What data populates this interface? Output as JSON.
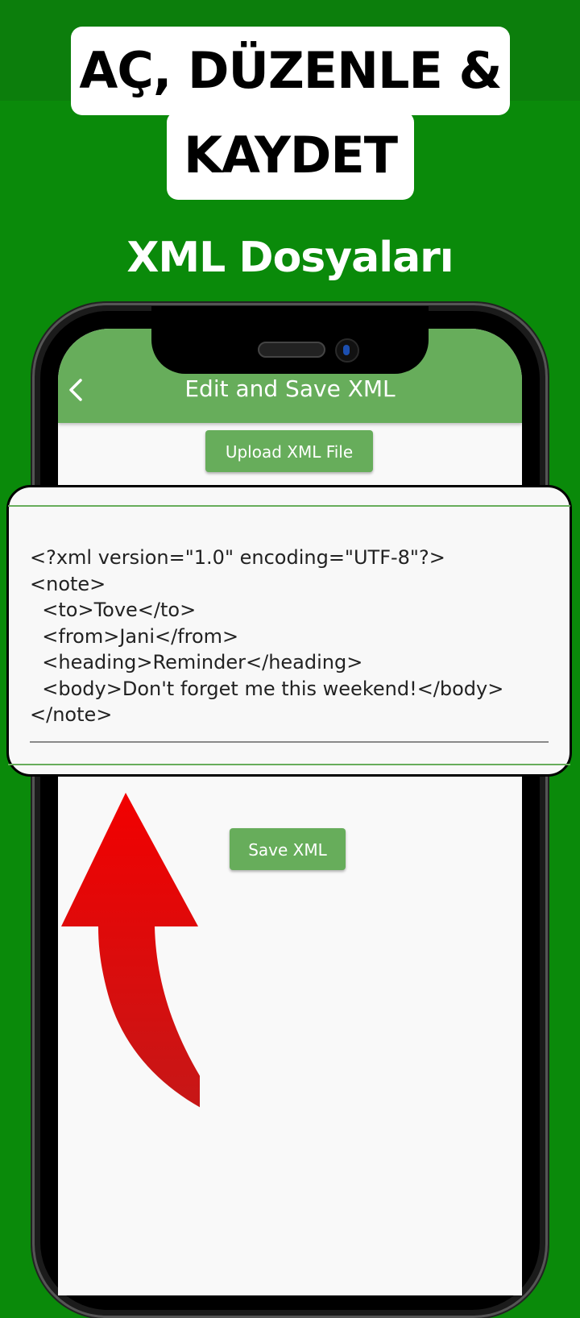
{
  "promo": {
    "headline_line1": "AÇ, DÜZENLE &",
    "headline_line2": "KAYDET",
    "subtitle": "XML Dosyaları"
  },
  "app": {
    "title": "Edit and Save XML",
    "back_icon": "chevron-left-icon",
    "upload_button": "Upload XML File",
    "save_button": "Save XML",
    "editor_value": "<?xml version=\"1.0\" encoding=\"UTF-8\"?>\n<note>\n  <to>Tove</to>\n  <from>Jani</from>\n  <heading>Reminder</heading>\n  <body>Don't forget me this weekend!</body>\n</note>"
  },
  "colors": {
    "background": "#0a8a0a",
    "appbar": "#67ad5b",
    "arrow": "#e00000"
  }
}
